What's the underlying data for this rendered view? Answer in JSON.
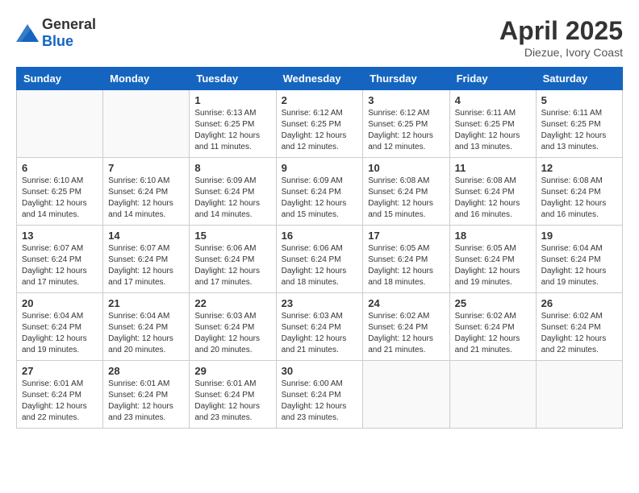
{
  "logo": {
    "general": "General",
    "blue": "Blue"
  },
  "title": {
    "month": "April 2025",
    "location": "Diezue, Ivory Coast"
  },
  "weekdays": [
    "Sunday",
    "Monday",
    "Tuesday",
    "Wednesday",
    "Thursday",
    "Friday",
    "Saturday"
  ],
  "weeks": [
    [
      {
        "day": "",
        "info": ""
      },
      {
        "day": "",
        "info": ""
      },
      {
        "day": "1",
        "info": "Sunrise: 6:13 AM\nSunset: 6:25 PM\nDaylight: 12 hours and 11 minutes."
      },
      {
        "day": "2",
        "info": "Sunrise: 6:12 AM\nSunset: 6:25 PM\nDaylight: 12 hours and 12 minutes."
      },
      {
        "day": "3",
        "info": "Sunrise: 6:12 AM\nSunset: 6:25 PM\nDaylight: 12 hours and 12 minutes."
      },
      {
        "day": "4",
        "info": "Sunrise: 6:11 AM\nSunset: 6:25 PM\nDaylight: 12 hours and 13 minutes."
      },
      {
        "day": "5",
        "info": "Sunrise: 6:11 AM\nSunset: 6:25 PM\nDaylight: 12 hours and 13 minutes."
      }
    ],
    [
      {
        "day": "6",
        "info": "Sunrise: 6:10 AM\nSunset: 6:25 PM\nDaylight: 12 hours and 14 minutes."
      },
      {
        "day": "7",
        "info": "Sunrise: 6:10 AM\nSunset: 6:24 PM\nDaylight: 12 hours and 14 minutes."
      },
      {
        "day": "8",
        "info": "Sunrise: 6:09 AM\nSunset: 6:24 PM\nDaylight: 12 hours and 14 minutes."
      },
      {
        "day": "9",
        "info": "Sunrise: 6:09 AM\nSunset: 6:24 PM\nDaylight: 12 hours and 15 minutes."
      },
      {
        "day": "10",
        "info": "Sunrise: 6:08 AM\nSunset: 6:24 PM\nDaylight: 12 hours and 15 minutes."
      },
      {
        "day": "11",
        "info": "Sunrise: 6:08 AM\nSunset: 6:24 PM\nDaylight: 12 hours and 16 minutes."
      },
      {
        "day": "12",
        "info": "Sunrise: 6:08 AM\nSunset: 6:24 PM\nDaylight: 12 hours and 16 minutes."
      }
    ],
    [
      {
        "day": "13",
        "info": "Sunrise: 6:07 AM\nSunset: 6:24 PM\nDaylight: 12 hours and 17 minutes."
      },
      {
        "day": "14",
        "info": "Sunrise: 6:07 AM\nSunset: 6:24 PM\nDaylight: 12 hours and 17 minutes."
      },
      {
        "day": "15",
        "info": "Sunrise: 6:06 AM\nSunset: 6:24 PM\nDaylight: 12 hours and 17 minutes."
      },
      {
        "day": "16",
        "info": "Sunrise: 6:06 AM\nSunset: 6:24 PM\nDaylight: 12 hours and 18 minutes."
      },
      {
        "day": "17",
        "info": "Sunrise: 6:05 AM\nSunset: 6:24 PM\nDaylight: 12 hours and 18 minutes."
      },
      {
        "day": "18",
        "info": "Sunrise: 6:05 AM\nSunset: 6:24 PM\nDaylight: 12 hours and 19 minutes."
      },
      {
        "day": "19",
        "info": "Sunrise: 6:04 AM\nSunset: 6:24 PM\nDaylight: 12 hours and 19 minutes."
      }
    ],
    [
      {
        "day": "20",
        "info": "Sunrise: 6:04 AM\nSunset: 6:24 PM\nDaylight: 12 hours and 19 minutes."
      },
      {
        "day": "21",
        "info": "Sunrise: 6:04 AM\nSunset: 6:24 PM\nDaylight: 12 hours and 20 minutes."
      },
      {
        "day": "22",
        "info": "Sunrise: 6:03 AM\nSunset: 6:24 PM\nDaylight: 12 hours and 20 minutes."
      },
      {
        "day": "23",
        "info": "Sunrise: 6:03 AM\nSunset: 6:24 PM\nDaylight: 12 hours and 21 minutes."
      },
      {
        "day": "24",
        "info": "Sunrise: 6:02 AM\nSunset: 6:24 PM\nDaylight: 12 hours and 21 minutes."
      },
      {
        "day": "25",
        "info": "Sunrise: 6:02 AM\nSunset: 6:24 PM\nDaylight: 12 hours and 21 minutes."
      },
      {
        "day": "26",
        "info": "Sunrise: 6:02 AM\nSunset: 6:24 PM\nDaylight: 12 hours and 22 minutes."
      }
    ],
    [
      {
        "day": "27",
        "info": "Sunrise: 6:01 AM\nSunset: 6:24 PM\nDaylight: 12 hours and 22 minutes."
      },
      {
        "day": "28",
        "info": "Sunrise: 6:01 AM\nSunset: 6:24 PM\nDaylight: 12 hours and 23 minutes."
      },
      {
        "day": "29",
        "info": "Sunrise: 6:01 AM\nSunset: 6:24 PM\nDaylight: 12 hours and 23 minutes."
      },
      {
        "day": "30",
        "info": "Sunrise: 6:00 AM\nSunset: 6:24 PM\nDaylight: 12 hours and 23 minutes."
      },
      {
        "day": "",
        "info": ""
      },
      {
        "day": "",
        "info": ""
      },
      {
        "day": "",
        "info": ""
      }
    ]
  ]
}
